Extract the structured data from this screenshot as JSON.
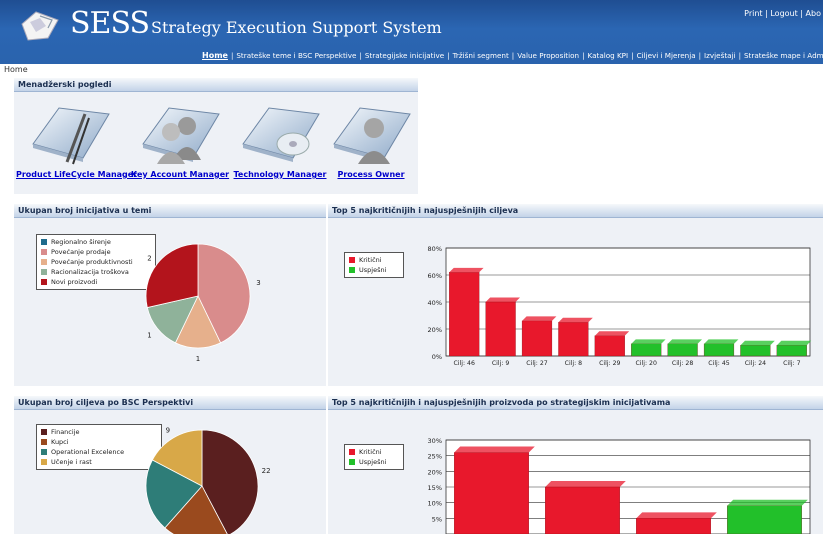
{
  "header": {
    "logo_text": "SESS",
    "subtitle": "Strategy Execution Support System",
    "util_links": [
      "Print",
      "Logout",
      "Abo"
    ],
    "nav": [
      "Home",
      "Strateške teme i BSC Perspektive",
      "Strategijske inicijative",
      "Tržišni segment",
      "Value Proposition",
      "Katalog KPI",
      "Ciljevi i Mjerenja",
      "Izvještaji",
      "Strateške mape i Administra"
    ]
  },
  "breadcrumb": "Home",
  "views_panel": {
    "title": "Menadžerski pogledi",
    "items": [
      {
        "label": "Product LifeCycle Manager",
        "icon": "pen-tool-icon"
      },
      {
        "label": "Key Account Manager",
        "icon": "users-icon"
      },
      {
        "label": "Technology Manager",
        "icon": "disc-icon"
      },
      {
        "label": "Process Owner",
        "icon": "user-icon"
      }
    ]
  },
  "panels": {
    "p1_title": "Ukupan broj inicijativa u temi",
    "p2_title": "Top 5 najkritičnijih i najuspješnijih ciljeva",
    "p3_title": "Ukupan broj ciljeva po BSC Perspektivi",
    "p4_title": "Top 5 najkritičnijih i najuspješnijih proizvoda po strategijskim inicijativama"
  },
  "chart_data": [
    {
      "type": "pie",
      "categories": [
        "Regionalno širenje",
        "Povećanje prodaje",
        "Povećanje produktivnosti",
        "Racionalizacija troškova",
        "Novi proizvodi"
      ],
      "values": [
        0,
        3,
        1,
        1,
        2
      ],
      "slice_labels": [
        "3",
        "1",
        "1",
        "2"
      ],
      "colors": [
        "#1f6b8c",
        "#d98c8c",
        "#e6b08c",
        "#8fb29a",
        "#b3141c"
      ],
      "legend": "left"
    },
    {
      "type": "bar",
      "categories": [
        "Cilj: 46",
        "Cilj: 9",
        "Cilj: 27",
        "Cilj: 8",
        "Cilj: 29",
        "Cilj: 20",
        "Cilj: 28",
        "Cilj: 45",
        "Cilj: 24",
        "Cilj: 7"
      ],
      "series": [
        {
          "name": "Kritični",
          "values": [
            62,
            40,
            26,
            25,
            15,
            null,
            null,
            null,
            null,
            null
          ]
        },
        {
          "name": "Uspješni",
          "values": [
            null,
            null,
            null,
            null,
            null,
            9,
            9,
            9,
            8,
            8
          ]
        }
      ],
      "colors": {
        "Kritični": "#e8182c",
        "Uspješni": "#22c02a"
      },
      "yticks": [
        "0%",
        "20%",
        "40%",
        "60%",
        "80%"
      ],
      "ylim": [
        0,
        80
      ]
    },
    {
      "type": "pie",
      "categories": [
        "Financije",
        "Kupci",
        "Operational Excelence",
        "Učenje i rast"
      ],
      "values": [
        22,
        10,
        11,
        9
      ],
      "slice_labels": [
        "22",
        "11",
        "9"
      ],
      "colors": [
        "#5a1f1f",
        "#9a4a1e",
        "#2e7d78",
        "#d8a848"
      ],
      "legend": "left"
    },
    {
      "type": "bar",
      "categories": [
        "",
        "",
        "",
        ""
      ],
      "series": [
        {
          "name": "Kritični",
          "values": [
            26,
            15,
            5,
            null
          ]
        },
        {
          "name": "Uspješni",
          "values": [
            null,
            null,
            null,
            9
          ]
        }
      ],
      "colors": {
        "Kritični": "#e8182c",
        "Uspješni": "#22c02a"
      },
      "yticks": [
        "5%",
        "10%",
        "15%",
        "20%",
        "25%",
        "30%"
      ],
      "ylim": [
        0,
        30
      ]
    }
  ]
}
